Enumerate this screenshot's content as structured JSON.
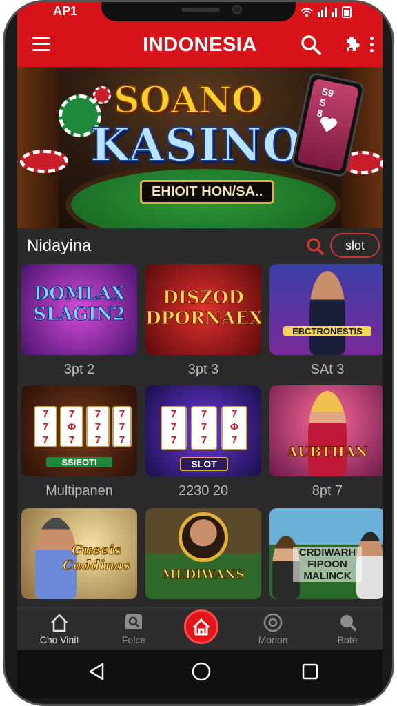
{
  "status": {
    "carrier": "AP1",
    "icons": "wifi signal battery"
  },
  "header": {
    "title": "INDONESIA",
    "menu_icon": "menu-icon",
    "search_icon": "search-icon",
    "puzzle_icon": "puzzle-icon",
    "more_icon": "more-vertical-icon"
  },
  "banner": {
    "line1": "SOANO",
    "line2": "KASINO",
    "tagline": "EHIOIT HON/SA..",
    "phone_text": "S9\nS\n8"
  },
  "section": {
    "label": "Nidayina",
    "filter_chip": "slot"
  },
  "games": [
    {
      "art": "DOMLAX SLAGIN2",
      "caption": "3pt 2"
    },
    {
      "art": "DISZOD DPORNAEX",
      "caption": "3pt 3"
    },
    {
      "art": "EBCTRONESTIS",
      "caption": "SAt 3"
    },
    {
      "art": "SSIEOTI",
      "caption": "Multipanen"
    },
    {
      "art": "SLOT",
      "caption": "2230 20"
    },
    {
      "art": "AUBTHAN",
      "caption": "8pt 7"
    },
    {
      "art": "Gueeis Caddinas",
      "caption": ""
    },
    {
      "art": "MEDIWANS",
      "caption": ""
    },
    {
      "art": "CRDIWARH FIPOON MALINCK",
      "caption": ""
    }
  ],
  "bottom_nav": [
    {
      "label": "Cho Vinit",
      "icon": "home-outline-icon"
    },
    {
      "label": "Folce",
      "icon": "search-box-icon"
    },
    {
      "label": "",
      "icon": "home-icon"
    },
    {
      "label": "Morion",
      "icon": "camera-icon"
    },
    {
      "label": "Bote",
      "icon": "search-icon"
    }
  ],
  "colors": {
    "brand_red": "#d8141b",
    "background": "#2a2a2a",
    "accent_gold": "#ffcf2e"
  }
}
